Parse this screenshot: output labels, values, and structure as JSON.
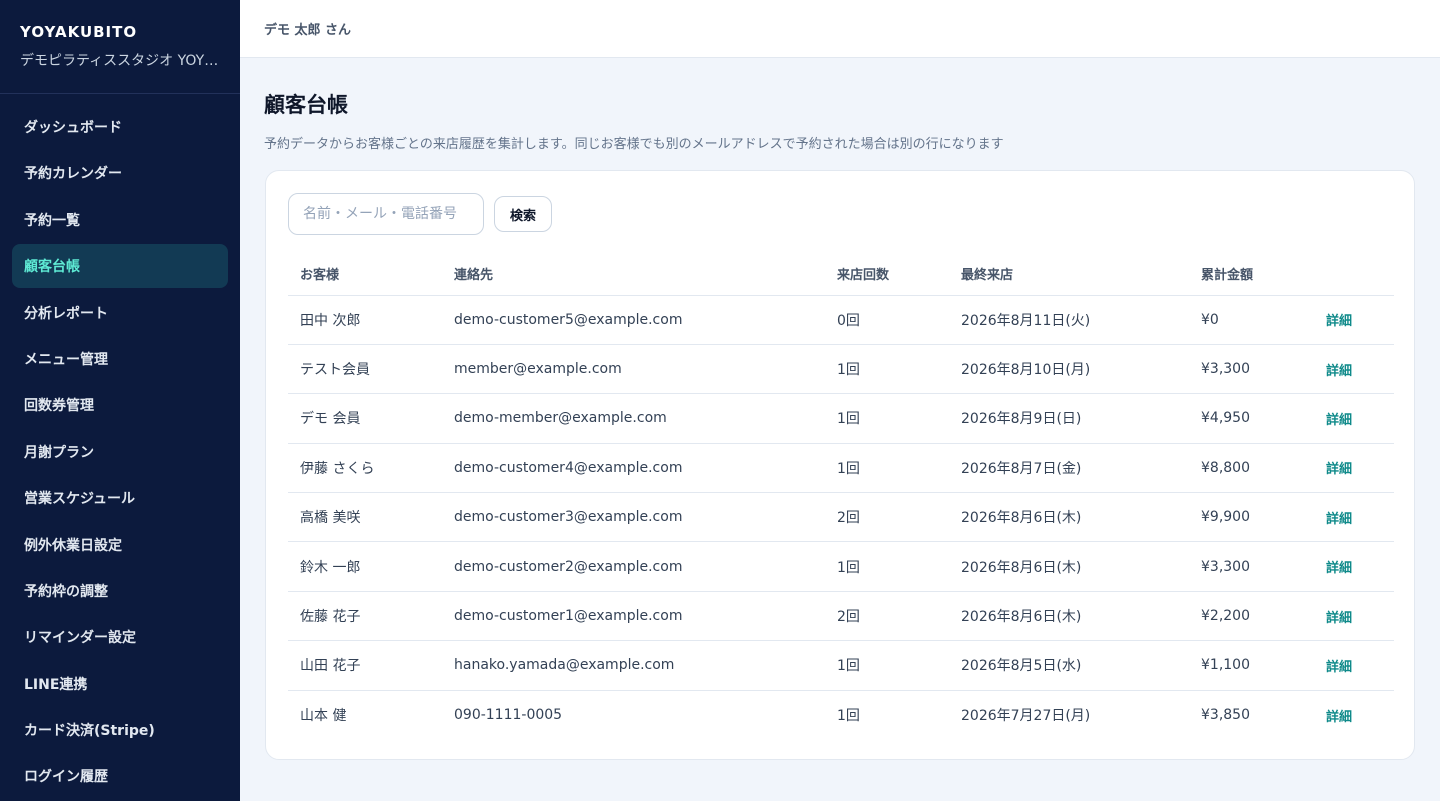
{
  "brand": {
    "title": "YOYAKUBITO",
    "subtitle": "デモピラティススタジオ YOY…"
  },
  "sidebar": {
    "items": [
      {
        "label": "ダッシュボード",
        "active": false
      },
      {
        "label": "予約カレンダー",
        "active": false
      },
      {
        "label": "予約一覧",
        "active": false
      },
      {
        "label": "顧客台帳",
        "active": true
      },
      {
        "label": "分析レポート",
        "active": false
      },
      {
        "label": "メニュー管理",
        "active": false
      },
      {
        "label": "回数券管理",
        "active": false
      },
      {
        "label": "月謝プラン",
        "active": false
      },
      {
        "label": "営業スケジュール",
        "active": false
      },
      {
        "label": "例外休業日設定",
        "active": false
      },
      {
        "label": "予約枠の調整",
        "active": false
      },
      {
        "label": "リマインダー設定",
        "active": false
      },
      {
        "label": "LINE連携",
        "active": false
      },
      {
        "label": "カード決済(Stripe)",
        "active": false
      },
      {
        "label": "ログイン履歴",
        "active": false
      }
    ]
  },
  "header": {
    "user_name": "デモ 太郎 さん"
  },
  "page": {
    "title": "顧客台帳",
    "description": "予約データからお客様ごとの来店履歴を集計します。同じお客様でも別のメールアドレスで予約された場合は別の行になります"
  },
  "search": {
    "placeholder": "名前・メール・電話番号",
    "value": "",
    "button_label": "検索"
  },
  "table": {
    "columns": [
      "お客様",
      "連絡先",
      "来店回数",
      "最終来店",
      "累計金額",
      ""
    ],
    "detail_label": "詳細",
    "rows": [
      {
        "name": "田中 次郎",
        "contact": "demo-customer5@example.com",
        "visits": "0回",
        "last_visit": "2026年8月11日(火)",
        "total": "¥0"
      },
      {
        "name": "テスト会員",
        "contact": "member@example.com",
        "visits": "1回",
        "last_visit": "2026年8月10日(月)",
        "total": "¥3,300"
      },
      {
        "name": "デモ 会員",
        "contact": "demo-member@example.com",
        "visits": "1回",
        "last_visit": "2026年8月9日(日)",
        "total": "¥4,950"
      },
      {
        "name": "伊藤 さくら",
        "contact": "demo-customer4@example.com",
        "visits": "1回",
        "last_visit": "2026年8月7日(金)",
        "total": "¥8,800"
      },
      {
        "name": "高橋 美咲",
        "contact": "demo-customer3@example.com",
        "visits": "2回",
        "last_visit": "2026年8月6日(木)",
        "total": "¥9,900"
      },
      {
        "name": "鈴木 一郎",
        "contact": "demo-customer2@example.com",
        "visits": "1回",
        "last_visit": "2026年8月6日(木)",
        "total": "¥3,300"
      },
      {
        "name": "佐藤 花子",
        "contact": "demo-customer1@example.com",
        "visits": "2回",
        "last_visit": "2026年8月6日(木)",
        "total": "¥2,200"
      },
      {
        "name": "山田 花子",
        "contact": "hanako.yamada@example.com",
        "visits": "1回",
        "last_visit": "2026年8月5日(水)",
        "total": "¥1,100"
      },
      {
        "name": "山本 健",
        "contact": "090-1111-0005",
        "visits": "1回",
        "last_visit": "2026年7月27日(月)",
        "total": "¥3,850"
      }
    ]
  },
  "colors": {
    "sidebar_bg": "#0c1a3d",
    "active_bg": "#123a54",
    "active_text": "#5eead4",
    "link": "#0f8a8a"
  }
}
